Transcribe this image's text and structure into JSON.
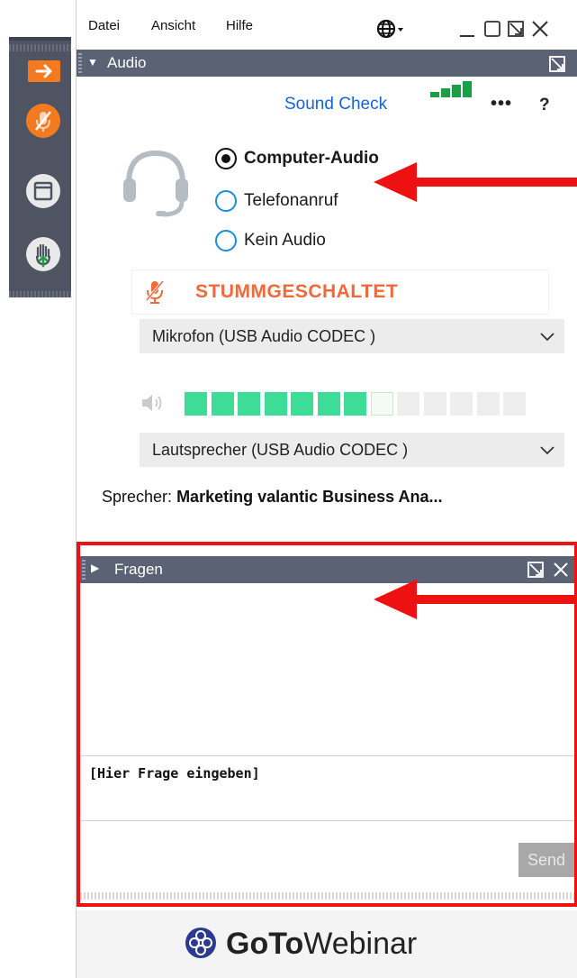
{
  "menu": {
    "items": [
      "Datei",
      "Ansicht",
      "Hilfe"
    ]
  },
  "audio_panel": {
    "title": "Audio",
    "sound_check": "Sound Check",
    "options": [
      {
        "label": "Computer-Audio",
        "selected": true
      },
      {
        "label": "Telefonanruf",
        "selected": false
      },
      {
        "label": "Kein Audio",
        "selected": false
      }
    ],
    "mute_status": "STUMMGESCHALTET",
    "microphone": "Mikrofon (USB Audio CODEC )",
    "speaker_device": "Lautsprecher (USB Audio CODEC )",
    "speaker_label": "Sprecher:",
    "speaker_name": "Marketing valantic Business Ana..."
  },
  "questions_panel": {
    "title": "Fragen",
    "input_placeholder": "[Hier Frage eingeben]",
    "send_label": "Send"
  },
  "footer": {
    "brand_bold": "GoTo",
    "brand_light": "Webinar"
  },
  "colors": {
    "accent_orange": "#f47a20",
    "panel_header": "#5a6273",
    "link_blue": "#1565d8",
    "level_green": "#3ddc97",
    "highlight_red": "#ee1111"
  },
  "icons": [
    "arrow-right-icon",
    "mic-muted-icon",
    "window-icon",
    "raise-hand-icon",
    "globe-icon",
    "minimize-icon",
    "maximize-icon",
    "popout-icon",
    "close-icon",
    "headset-icon",
    "speaker-icon",
    "chevron-down-icon",
    "gotowebinar-logo-icon"
  ],
  "speaker_level": 0.54
}
